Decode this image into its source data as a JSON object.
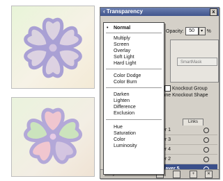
{
  "palette": {
    "title": "‹ Transparency",
    "close_glyph": "x"
  },
  "opacity": {
    "label": "Opacity:",
    "value": "50",
    "unit": "%",
    "arrow": "▾"
  },
  "options": {
    "smartmask_label": "SmartMask",
    "knockout_group": "Knockout Group",
    "define_knockout_shape": "efine Knockout Shape"
  },
  "blend_menu": {
    "checkmark": "•",
    "items": [
      "Normal",
      "Multiply",
      "Screen",
      "Overlay",
      "Soft Light",
      "Hard Light",
      "Color Dodge",
      "Color Burn",
      "Darken",
      "Lighten",
      "Difference",
      "Exclusion",
      "Hue",
      "Saturation",
      "Color",
      "Luminosity"
    ],
    "selected": "Normal"
  },
  "layers": {
    "tab_label": "Links",
    "rows": [
      {
        "name": "er 1"
      },
      {
        "name": "er 3"
      },
      {
        "name": "er 4"
      },
      {
        "name": "er 2"
      },
      {
        "name": "Layer 5"
      }
    ],
    "status": "5 Layers"
  },
  "icons": {
    "nav_first": "▮",
    "nav_play": "▷",
    "btn_new": "+",
    "btn_trash": "✕"
  },
  "colors": {
    "flower_stroke": "#a9a0d4",
    "flower_fill": "#c9b8e0",
    "flower_pink": "#f0b8c8",
    "flower_green": "#bfe0b0",
    "selection": "#3a4f8a"
  }
}
